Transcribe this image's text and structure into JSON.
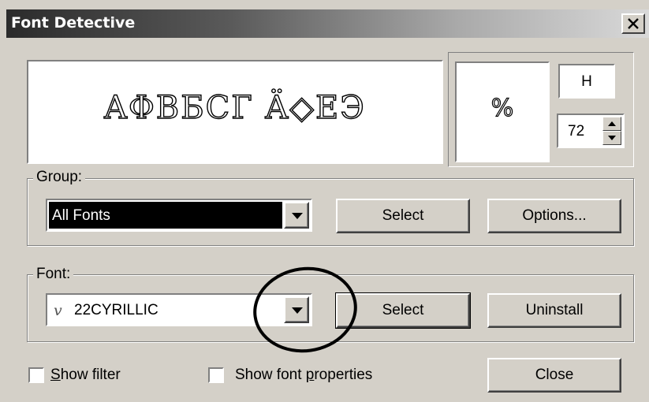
{
  "window": {
    "title": "Font Detective"
  },
  "preview": {
    "sample_text": "AΦBБCГ Ä◇EЭ"
  },
  "character": {
    "glyph": "%",
    "hex_value": "H",
    "size_value": "72"
  },
  "group": {
    "label": "Group:",
    "selected": "All Fonts",
    "select_label": "Select",
    "options_label": "Options..."
  },
  "font": {
    "label": "Font:",
    "selected": "22CYRILLIC",
    "type_icon": "v",
    "select_label": "Select",
    "uninstall_label": "Uninstall"
  },
  "footer": {
    "show_filter_prefix": "S",
    "show_filter_rest": "how filter",
    "show_props_prefix": "Show font ",
    "show_props_underlined": "p",
    "show_props_rest": "roperties",
    "close_label": "Close"
  }
}
